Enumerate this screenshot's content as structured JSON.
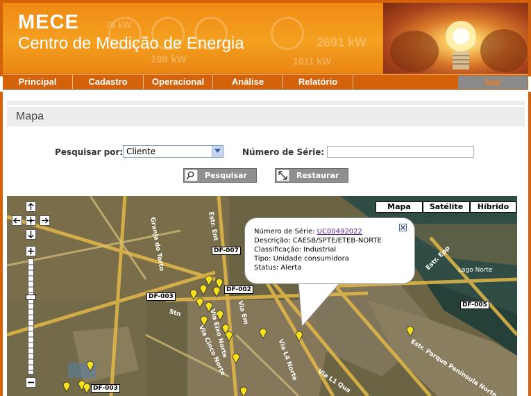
{
  "header": {
    "title": "MECE",
    "subtitle": "Centro de Medição de Energia",
    "bg_readings": [
      "75 kW",
      "198 kW",
      "2691 kW",
      "1011 kW"
    ]
  },
  "nav": {
    "items": [
      "Principal",
      "Cadastro",
      "Operacional",
      "Análise",
      "Relatório"
    ],
    "exit": "Sair"
  },
  "page": {
    "section_title": "Mapa"
  },
  "search": {
    "search_by_label": "Pesquisar por:",
    "search_by_value": "Cliente",
    "serial_label": "Número de Série:",
    "serial_value": "",
    "search_button": "Pesquisar",
    "reset_button": "Restaurar"
  },
  "map": {
    "map_types": [
      "Mapa",
      "Satélite",
      "Híbrido"
    ],
    "road_labels": {
      "df007": "DF-007",
      "df002": "DF-002",
      "df003_top": "DF-003",
      "df005": "DF-005",
      "df003_bottom": "DF-003"
    },
    "street_labels": {
      "granja": "Granja do Torto",
      "estr_ent": "Estr. Ent",
      "lago_norte": "Lago Norte",
      "estr_epp": "Estr. Epp",
      "parque": "Estr. Parque Península Norte",
      "via_l4": "Via L4 Norte",
      "via_l4_ext": "Via L4 Norte",
      "via_l1": "Via L1 Qua",
      "via_em": "Via Em",
      "eixo": "Via Eixo Norte",
      "cinco": "Via Cinco Norte",
      "stn": "Stn"
    },
    "popup": {
      "serial_label": "Número de Série:",
      "serial_link": "UC00492022",
      "description": "Descrição: CAESB/SPTE/ETEB-NORTE",
      "classification": "Classificação: Industrial",
      "type": "Tipo: Unidade consumidora",
      "status": "Status: Alerta"
    }
  },
  "colors": {
    "brand_orange": "#d4620a",
    "header_orange": "#f4a020",
    "exit_button": "#8a8a8a",
    "map_road": "#e8b84a"
  }
}
